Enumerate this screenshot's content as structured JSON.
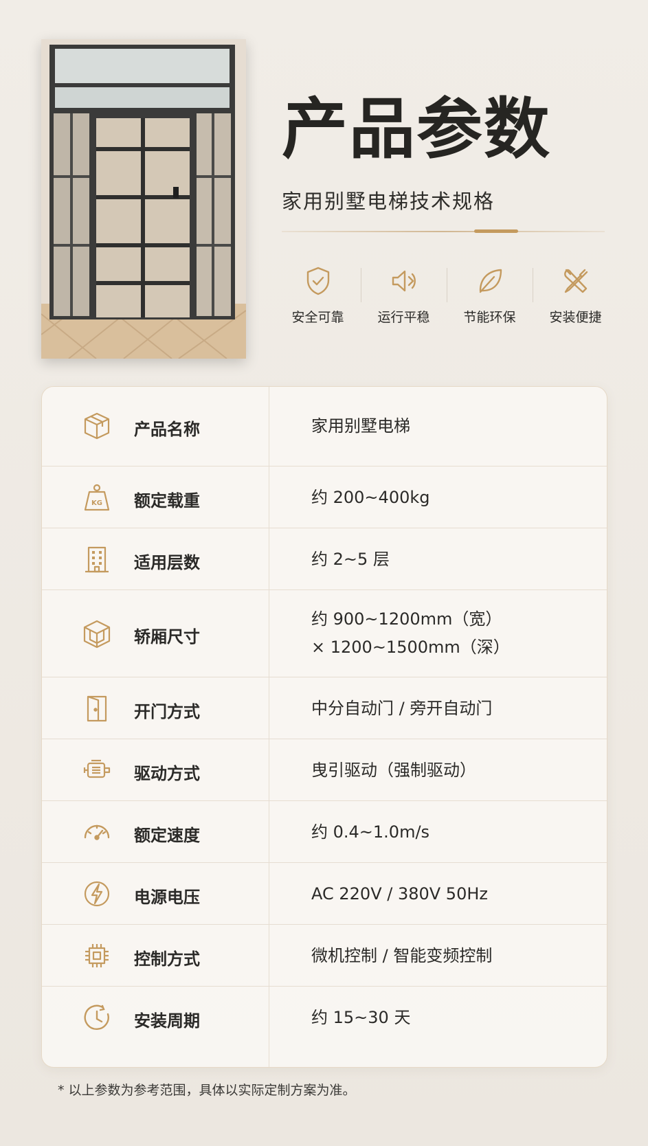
{
  "page": {
    "title": "产品参数",
    "subtitle": "家用别墅电梯技术规格",
    "accent_color": "#c49a5e"
  },
  "features": [
    {
      "label": "安全可靠",
      "icon": "shield-check-icon"
    },
    {
      "label": "运行平稳",
      "icon": "speaker-wave-icon"
    },
    {
      "label": "节能环保",
      "icon": "leaf-icon"
    },
    {
      "label": "安装便捷",
      "icon": "wrench-screwdriver-icon"
    }
  ],
  "specs": [
    {
      "icon": "box-icon",
      "label": "产品名称",
      "value": "家用别墅电梯"
    },
    {
      "icon": "weight-kg-icon",
      "label": "额定载重",
      "value": "约 200~400kg"
    },
    {
      "icon": "building-icon",
      "label": "适用层数",
      "value": "约 2~5 层"
    },
    {
      "icon": "cube-icon",
      "label": "轿厢尺寸",
      "value": "约 900~1200mm（宽）",
      "value2": "× 1200~1500mm（深）"
    },
    {
      "icon": "door-icon",
      "label": "开门方式",
      "value": "中分自动门 / 旁开自动门"
    },
    {
      "icon": "motor-icon",
      "label": "驱动方式",
      "value": "曳引驱动（强制驱动）"
    },
    {
      "icon": "speedometer-icon",
      "label": "额定速度",
      "value": "约 0.4~1.0m/s"
    },
    {
      "icon": "lightning-icon",
      "label": "电源电压",
      "value": "AC 220V / 380V  50Hz"
    },
    {
      "icon": "chip-icon",
      "label": "控制方式",
      "value": "微机控制 / 智能变频控制"
    },
    {
      "icon": "clock-icon",
      "label": "安装周期",
      "value": "约 15~30 天"
    }
  ],
  "footnote": "* 以上参数为参考范围，具体以实际定制方案为准。"
}
